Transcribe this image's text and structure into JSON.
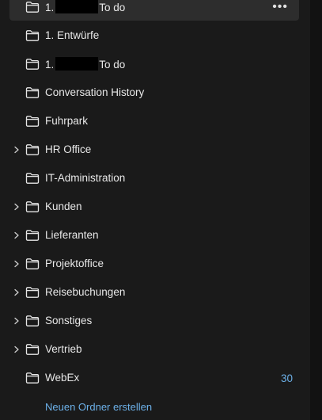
{
  "folders": [
    {
      "prefix": "1.",
      "suffix": "To do",
      "redacted": true,
      "expandable": false,
      "selected": true,
      "more": "•••"
    },
    {
      "prefix": "1. Entwürfe",
      "suffix": "",
      "redacted": false,
      "expandable": false
    },
    {
      "prefix": "1.",
      "suffix": "To do",
      "redacted": true,
      "expandable": false
    },
    {
      "prefix": "Conversation History",
      "suffix": "",
      "redacted": false,
      "expandable": false
    },
    {
      "prefix": "Fuhrpark",
      "suffix": "",
      "redacted": false,
      "expandable": false
    },
    {
      "prefix": "HR Office",
      "suffix": "",
      "redacted": false,
      "expandable": true
    },
    {
      "prefix": "IT-Administration",
      "suffix": "",
      "redacted": false,
      "expandable": false
    },
    {
      "prefix": "Kunden",
      "suffix": "",
      "redacted": false,
      "expandable": true
    },
    {
      "prefix": "Lieferanten",
      "suffix": "",
      "redacted": false,
      "expandable": true
    },
    {
      "prefix": "Projektoffice",
      "suffix": "",
      "redacted": false,
      "expandable": true
    },
    {
      "prefix": "Reisebuchungen",
      "suffix": "",
      "redacted": false,
      "expandable": true
    },
    {
      "prefix": "Sonstiges",
      "suffix": "",
      "redacted": false,
      "expandable": true
    },
    {
      "prefix": "Vertrieb",
      "suffix": "",
      "redacted": false,
      "expandable": true
    },
    {
      "prefix": "WebEx",
      "suffix": "",
      "redacted": false,
      "expandable": false,
      "count": "30"
    }
  ],
  "new_folder_label": "Neuen Ordner erstellen",
  "icons": {
    "folder": "folder-icon",
    "chevron": "chevron-right-icon",
    "more": "more-options-icon"
  },
  "colors": {
    "background": "#1a1a1a",
    "selected": "#2d2d2d",
    "accent": "#6cb0e8",
    "text": "#e8e8e8"
  }
}
